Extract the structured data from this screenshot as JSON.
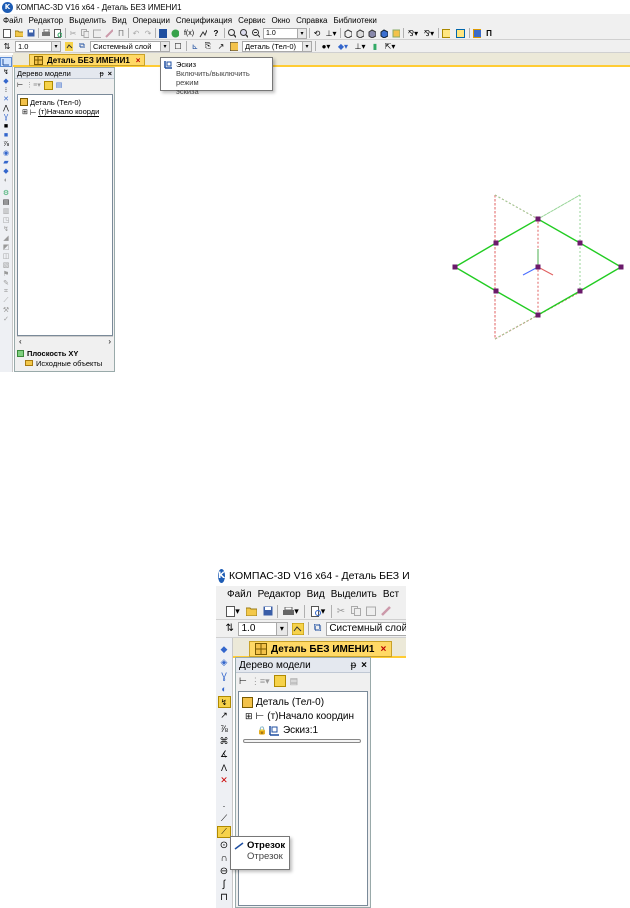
{
  "top": {
    "window_title": "КОМПАС-3D V16  x64 - Деталь БЕЗ ИМЕНИ1",
    "menu": [
      "Файл",
      "Редактор",
      "Выделить",
      "Вид",
      "Операции",
      "Спецификация",
      "Сервис",
      "Окно",
      "Справка",
      "Библиотеки"
    ],
    "scale_value": "1.0",
    "zoom_value": "1.0",
    "layer_value": "Системный слой",
    "body_value": "Деталь (Тел-0)",
    "doc_tab": "Деталь БЕЗ ИМЕНИ1",
    "doc_tab_close": "×",
    "tooltip_title": "Эскиз",
    "tooltip_desc_line1": "Включить/выключить режим",
    "tooltip_desc_line2": "эскиза",
    "panel_title": "Дерево модели",
    "panel_pin": "ᵽ",
    "panel_close": "×",
    "tree_root": "Деталь (Тел-0)",
    "tree_origin": "(т)Начало коорди",
    "scroll_left": "‹",
    "scroll_right": "›",
    "plane_title": "Плоскость XY",
    "plane_child": "Исходные объекты"
  },
  "bottom": {
    "window_title": "КОМПАС-3D V16  x64 - Деталь БЕЗ И",
    "menu": [
      "Файл",
      "Редактор",
      "Вид",
      "Выделить",
      "Вст"
    ],
    "scale_value": "1.0",
    "layer_value": "Системный слой",
    "doc_tab": "Деталь БЕЗ ИМЕНИ1",
    "doc_tab_close": "×",
    "panel_title": "Дерево модели",
    "panel_pin": "ᵽ",
    "panel_close": "×",
    "tree_root": "Деталь (Тел-0)",
    "tree_origin": "(т)Начало координ",
    "tree_sketch": "Эскиз:1",
    "tooltip_title": "Отрезок",
    "tooltip_desc": "Отрезок"
  },
  "colors": {
    "sketch_green": "#22cc22",
    "axis_red": "#e06060",
    "axis_green": "#9ad69a",
    "vertex": "#6b1a6b",
    "tab_yellow": "#ffd966",
    "logo_blue": "#1e5db5"
  }
}
